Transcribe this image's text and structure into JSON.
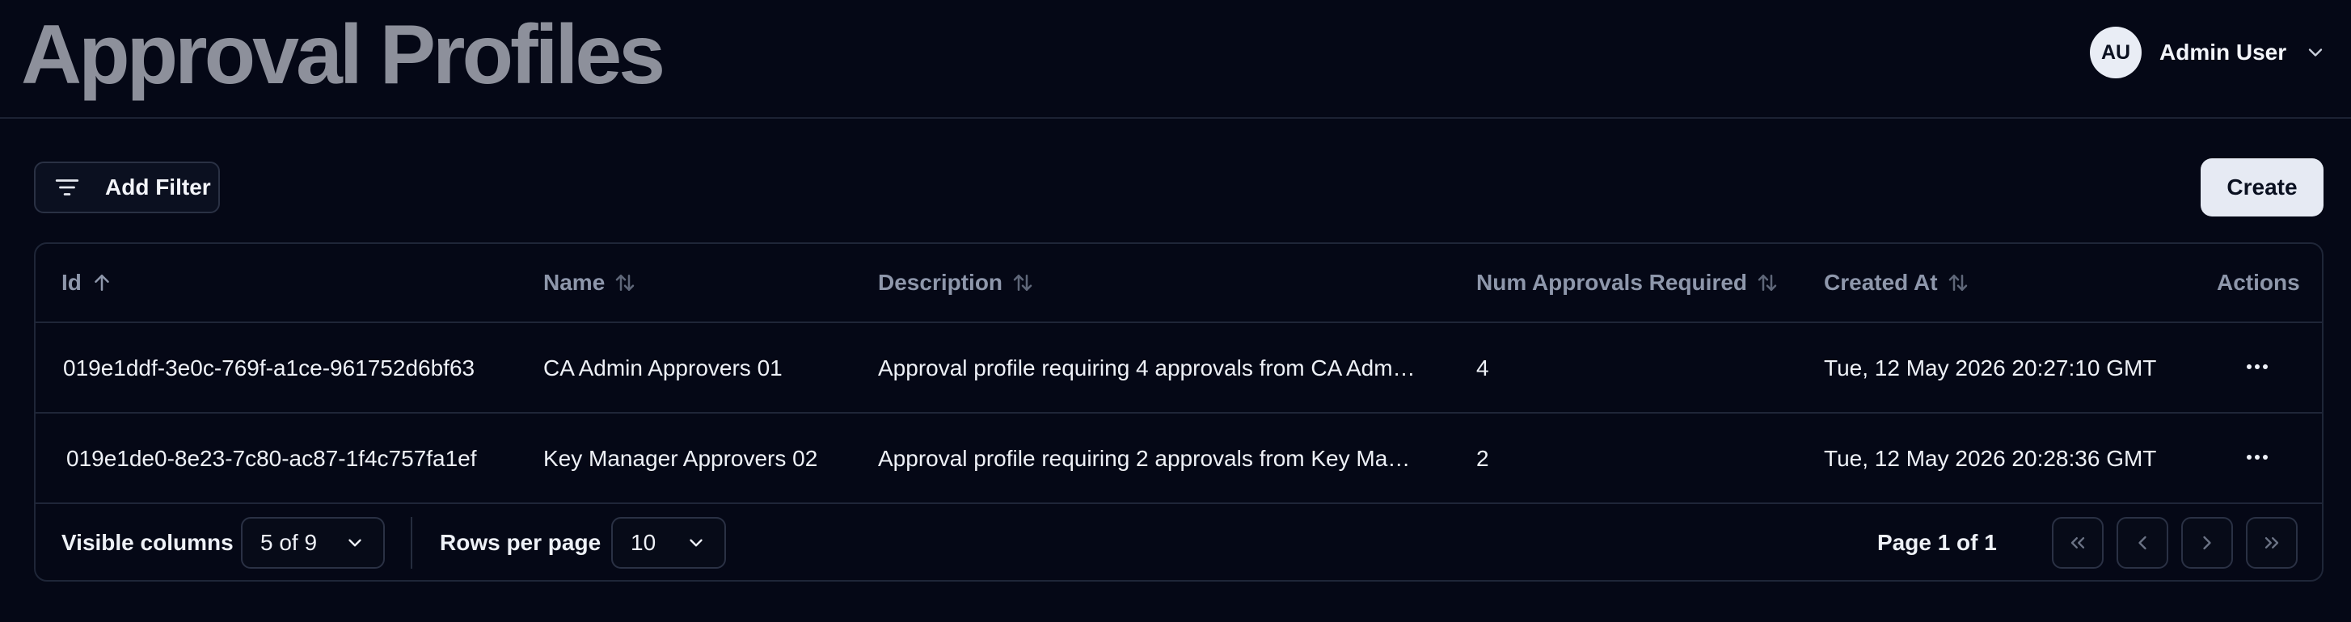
{
  "header": {
    "title": "Approval Profiles",
    "user": {
      "initials": "AU",
      "name": "Admin User"
    }
  },
  "toolbar": {
    "add_filter_label": "Add Filter",
    "create_label": "Create"
  },
  "table": {
    "columns": [
      {
        "label": "Id",
        "sort": "asc"
      },
      {
        "label": "Name",
        "sort": "none"
      },
      {
        "label": "Description",
        "sort": "none"
      },
      {
        "label": "Num Approvals Required",
        "sort": "none"
      },
      {
        "label": "Created At",
        "sort": "none"
      },
      {
        "label": "Actions"
      }
    ],
    "rows": [
      {
        "id": "019e1ddf-3e0c-769f-a1ce-961752d6bf63",
        "name": "CA Admin Approvers 01",
        "description": "Approval profile requiring 4 approvals from CA Adm…",
        "num_approvals": "4",
        "created_at": "Tue, 12 May 2026 20:27:10 GMT",
        "actions": "…"
      },
      {
        "id": "019e1de0-8e23-7c80-ac87-1f4c757fa1ef",
        "name": "Key Manager Approvers 02",
        "description": "Approval profile requiring 2 approvals from Key Ma…",
        "num_approvals": "2",
        "created_at": "Tue, 12 May 2026 20:28:36 GMT",
        "actions": "…"
      }
    ]
  },
  "footer": {
    "visible_columns_label": "Visible columns",
    "visible_columns_value": "5 of 9",
    "rows_per_page_label": "Rows per page",
    "rows_per_page_value": "10",
    "page_info": "Page 1 of 1"
  },
  "colors": {
    "background": "#050816",
    "title": "#8d909b",
    "border": "#1f2638",
    "header_text": "#8e97ab",
    "create_button": "#e6eaf3"
  }
}
